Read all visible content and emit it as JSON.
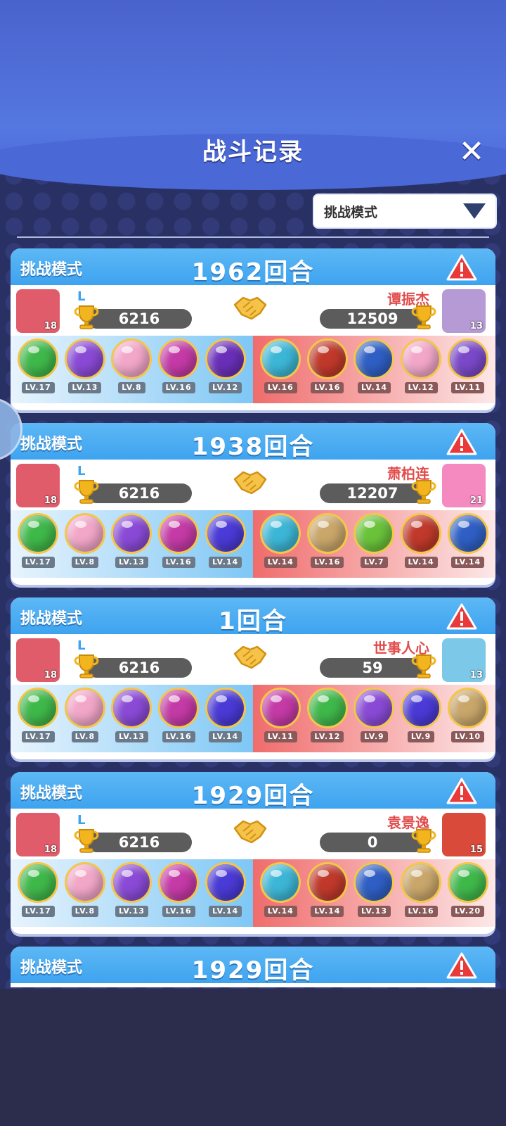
{
  "header": {
    "title": "战斗记录",
    "close_label": "✕"
  },
  "filter": {
    "selected": "挑战模式"
  },
  "colors": {
    "accent_blue": "#3ea3ef",
    "opponent_red": "#e14d4d"
  },
  "records": [
    {
      "mode": "挑战模式",
      "rounds": "1962回合",
      "left": {
        "name": "L",
        "score": "6216",
        "avatar_level": "18",
        "avatar_color": "#e05c6a",
        "pets": [
          {
            "lv": "LV.17",
            "color": "#3fb84a"
          },
          {
            "lv": "LV.13",
            "color": "#8a4ad6"
          },
          {
            "lv": "LV.8",
            "color": "#f2a6c8"
          },
          {
            "lv": "LV.16",
            "color": "#c43aa6"
          },
          {
            "lv": "LV.12",
            "color": "#6a2fb8"
          }
        ]
      },
      "right": {
        "name": "谭振杰",
        "score": "12509",
        "avatar_level": "13",
        "avatar_color": "#b59ad6",
        "pets": [
          {
            "lv": "LV.16",
            "color": "#3cb6d6"
          },
          {
            "lv": "LV.16",
            "color": "#c0392b"
          },
          {
            "lv": "LV.14",
            "color": "#2f5fc4"
          },
          {
            "lv": "LV.12",
            "color": "#f2a6c8"
          },
          {
            "lv": "LV.11",
            "color": "#7a48c8"
          }
        ]
      }
    },
    {
      "mode": "挑战模式",
      "rounds": "1938回合",
      "left": {
        "name": "L",
        "score": "6216",
        "avatar_level": "18",
        "avatar_color": "#e05c6a",
        "pets": [
          {
            "lv": "LV.17",
            "color": "#3fb84a"
          },
          {
            "lv": "LV.8",
            "color": "#f2a6c8"
          },
          {
            "lv": "LV.13",
            "color": "#8a4ad6"
          },
          {
            "lv": "LV.16",
            "color": "#c43aa6"
          },
          {
            "lv": "LV.14",
            "color": "#4a3ad6"
          }
        ]
      },
      "right": {
        "name": "萧柏连",
        "score": "12207",
        "avatar_level": "21",
        "avatar_color": "#f58ac0",
        "pets": [
          {
            "lv": "LV.14",
            "color": "#3cb6d6"
          },
          {
            "lv": "LV.16",
            "color": "#c9a66a"
          },
          {
            "lv": "LV.7",
            "color": "#6ac23a"
          },
          {
            "lv": "LV.14",
            "color": "#c0392b"
          },
          {
            "lv": "LV.14",
            "color": "#2f5fc4"
          }
        ]
      }
    },
    {
      "mode": "挑战模式",
      "rounds": "1回合",
      "left": {
        "name": "L",
        "score": "6216",
        "avatar_level": "18",
        "avatar_color": "#e05c6a",
        "pets": [
          {
            "lv": "LV.17",
            "color": "#3fb84a"
          },
          {
            "lv": "LV.8",
            "color": "#f2a6c8"
          },
          {
            "lv": "LV.13",
            "color": "#8a4ad6"
          },
          {
            "lv": "LV.16",
            "color": "#c43aa6"
          },
          {
            "lv": "LV.14",
            "color": "#4a3ad6"
          }
        ]
      },
      "right": {
        "name": "世事人心",
        "score": "59",
        "avatar_level": "13",
        "avatar_color": "#7cc8e8",
        "pets": [
          {
            "lv": "LV.11",
            "color": "#c43aa6"
          },
          {
            "lv": "LV.12",
            "color": "#3fb84a"
          },
          {
            "lv": "LV.9",
            "color": "#8a4ad6"
          },
          {
            "lv": "LV.9",
            "color": "#4a3ad6"
          },
          {
            "lv": "LV.10",
            "color": "#c9a66a"
          }
        ]
      }
    },
    {
      "mode": "挑战模式",
      "rounds": "1929回合",
      "left": {
        "name": "L",
        "score": "6216",
        "avatar_level": "18",
        "avatar_color": "#e05c6a",
        "pets": [
          {
            "lv": "LV.17",
            "color": "#3fb84a"
          },
          {
            "lv": "LV.8",
            "color": "#f2a6c8"
          },
          {
            "lv": "LV.13",
            "color": "#8a4ad6"
          },
          {
            "lv": "LV.16",
            "color": "#c43aa6"
          },
          {
            "lv": "LV.14",
            "color": "#4a3ad6"
          }
        ]
      },
      "right": {
        "name": "袁景逸",
        "score": "0",
        "avatar_level": "15",
        "avatar_color": "#d94a3a",
        "pets": [
          {
            "lv": "LV.14",
            "color": "#3cb6d6"
          },
          {
            "lv": "LV.14",
            "color": "#c0392b"
          },
          {
            "lv": "LV.13",
            "color": "#2f5fc4"
          },
          {
            "lv": "LV.16",
            "color": "#c9a66a"
          },
          {
            "lv": "LV.20",
            "color": "#3fb84a"
          }
        ]
      }
    },
    {
      "mode": "挑战模式",
      "rounds": "1929回合",
      "left": {
        "name": "",
        "score": "",
        "avatar_level": "",
        "avatar_color": "#e05c6a",
        "pets": []
      },
      "right": {
        "name": "",
        "score": "",
        "avatar_level": "",
        "avatar_color": "#d94a3a",
        "pets": []
      }
    }
  ]
}
